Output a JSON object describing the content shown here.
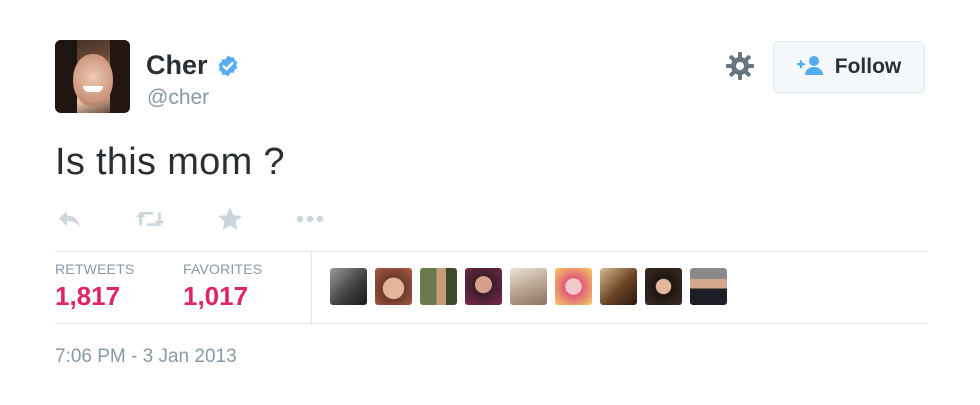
{
  "user": {
    "display_name": "Cher",
    "handle": "@cher",
    "verified": true
  },
  "follow_button": {
    "label": "Follow",
    "icon": "add-user-icon"
  },
  "settings_icon": "gear-icon",
  "tweet": {
    "text": "Is this mom ?",
    "timestamp": "7:06 PM - 3 Jan 2013"
  },
  "actions": [
    {
      "name": "reply",
      "icon": "reply-icon"
    },
    {
      "name": "retweet",
      "icon": "retweet-icon"
    },
    {
      "name": "favorite",
      "icon": "star-icon"
    },
    {
      "name": "more",
      "icon": "more-dots-icon"
    }
  ],
  "stats": {
    "retweets": {
      "label": "RETWEETS",
      "value": "1,817"
    },
    "favorites": {
      "label": "FAVORITES",
      "value": "1,017"
    }
  },
  "favoriters_count_shown": 9,
  "colors": {
    "text": "#292f33",
    "secondary": "#8899a6",
    "accent": "#55acee",
    "stat": "#e0245e",
    "divider": "#e1e8ed",
    "icon": "#ccd6dd"
  }
}
